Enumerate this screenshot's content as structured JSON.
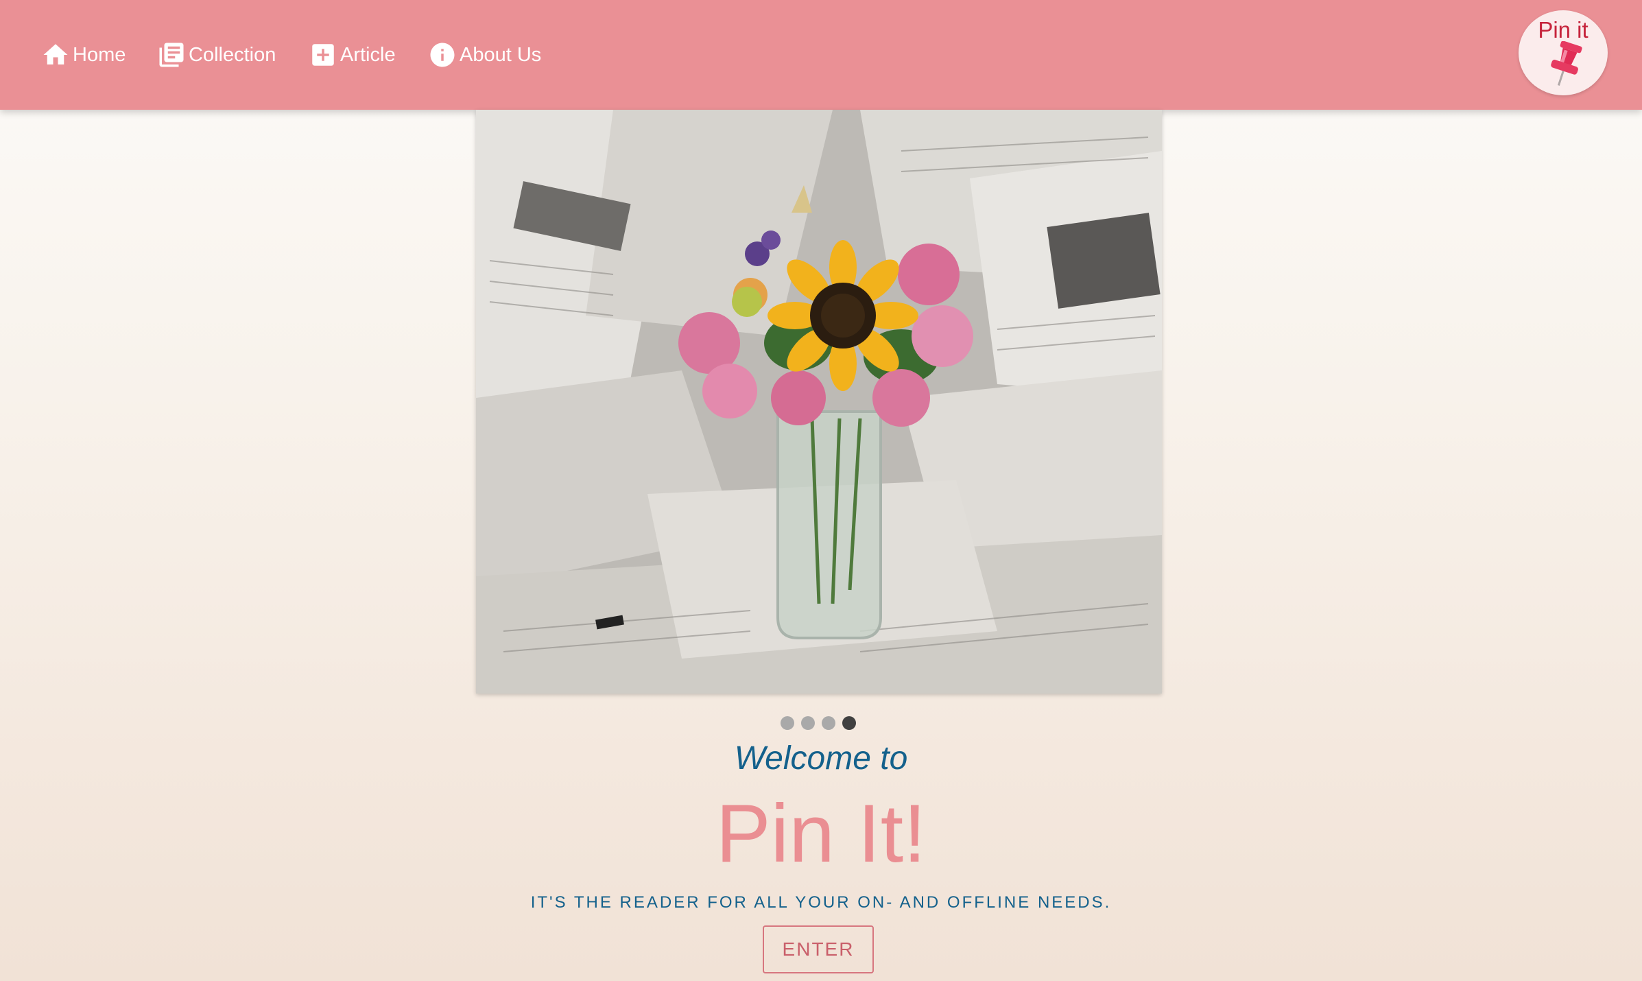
{
  "nav": {
    "items": [
      {
        "label": "Home",
        "icon": "home-icon"
      },
      {
        "label": "Collection",
        "icon": "collection-icon"
      },
      {
        "label": "Article",
        "icon": "add-box-icon"
      },
      {
        "label": "About Us",
        "icon": "info-icon"
      }
    ],
    "logo_text": "Pin it",
    "logo_icon": "pushpin-icon"
  },
  "carousel": {
    "slide_count": 4,
    "active_index": 3,
    "image_description": "sunflower and pink flowers in glass jar on newspapers"
  },
  "hero": {
    "welcome": "Welcome to",
    "title": "Pin It!",
    "tagline": "IT'S THE READER FOR ALL YOUR ON- AND OFFLINE NEEDS.",
    "enter_label": "ENTER"
  },
  "colors": {
    "navbar": "#ea9095",
    "accent_blue": "#14618c",
    "title_pink": "#ea8e92",
    "logo_red": "#c6243c"
  }
}
